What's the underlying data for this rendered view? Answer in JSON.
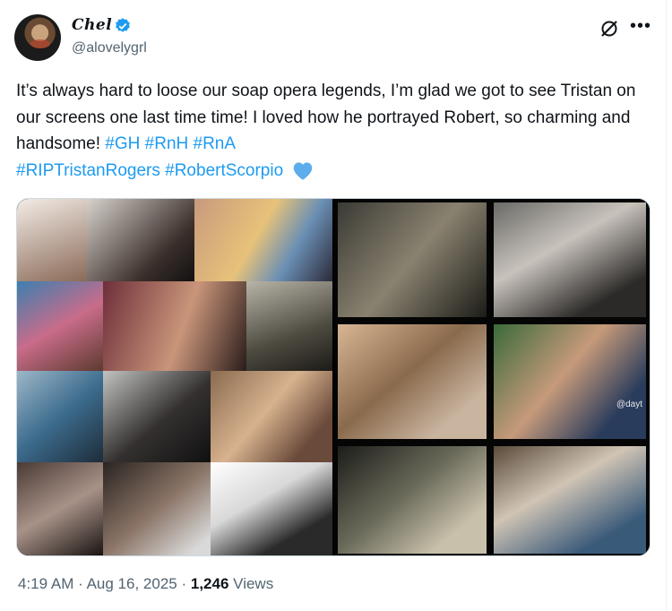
{
  "author": {
    "display_name": "Chel",
    "handle": "@alovelygrl",
    "verified_icon": "verified-badge-icon",
    "badge_color": "#1d9bf0"
  },
  "post": {
    "text_part1": "It’s always hard to loose our soap opera legends, I’m glad we got to see Tristan on our screens one last time time! I loved how he portrayed Robert, so charming and handsome! ",
    "hashtags": [
      "#GH",
      "#RnH",
      "#RnA",
      "#RIPTristanRogers",
      "#RobertScorpio"
    ],
    "emoji": "blue-heart-icon"
  },
  "media": {
    "left_image": "collage-photos-left",
    "right_image": "collage-photos-right",
    "watermark": "@dayt"
  },
  "meta": {
    "time": "4:19 AM",
    "sep": "·",
    "date": "Aug 16, 2025",
    "views_count": "1,246",
    "views_label": "Views"
  },
  "colors": {
    "link": "#1d9bf0",
    "muted": "#536471",
    "text": "#0f1419"
  }
}
